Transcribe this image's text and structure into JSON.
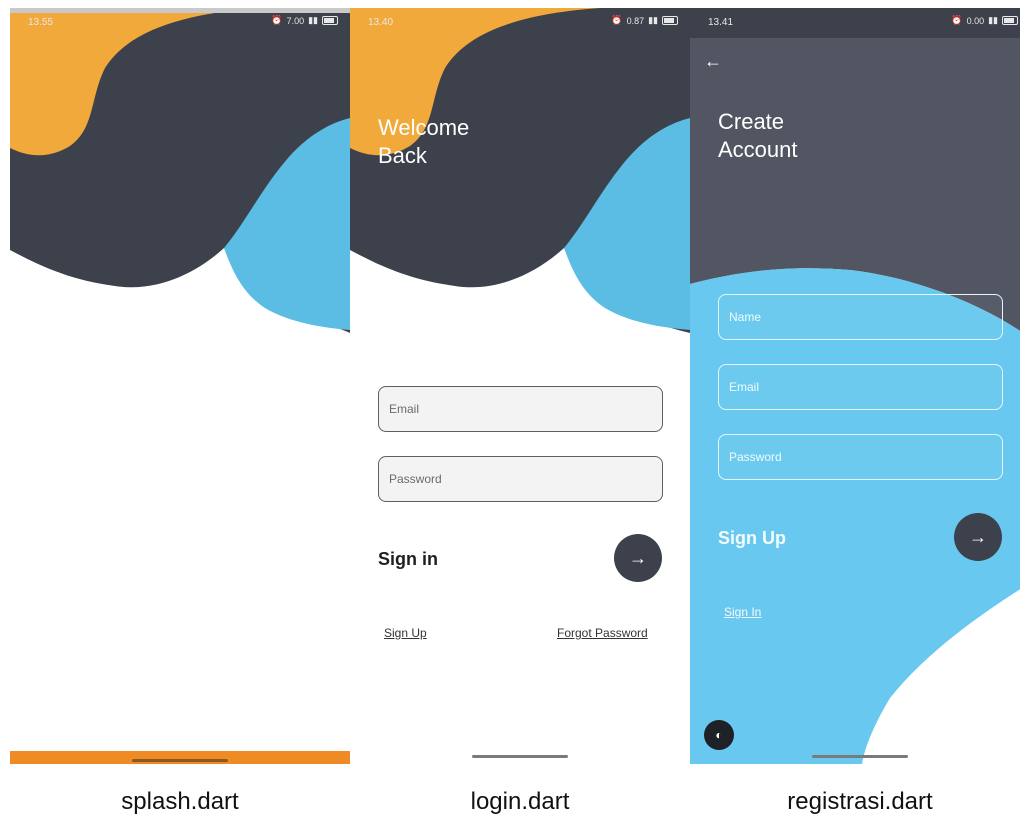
{
  "screens": {
    "splash": {
      "time": "13.55",
      "status_icons": "7.00",
      "caption": "splash.dart",
      "colors": {
        "orange": "#f2a93b",
        "dark": "#3d414b",
        "blue": "#5bbde4",
        "bottom_bar": "#f08a24"
      }
    },
    "login": {
      "time": "13.40",
      "status_icons": "0.87",
      "title_line1": "Welcome",
      "title_line2": "Back",
      "email_placeholder": "Email",
      "password_placeholder": "Password",
      "signin_label": "Sign in",
      "signup_link": "Sign Up",
      "forgot_link": "Forgot Password",
      "arrow_icon": "→",
      "caption": "login.dart"
    },
    "register": {
      "time": "13.41",
      "status_icons": "0.00",
      "back_icon": "←",
      "title_line1": "Create",
      "title_line2": "Account",
      "name_placeholder": "Name",
      "email_placeholder": "Email",
      "password_placeholder": "Password",
      "signup_label": "Sign Up",
      "signin_link": "Sign In",
      "arrow_icon": "→",
      "caption": "registrasi.dart"
    }
  }
}
